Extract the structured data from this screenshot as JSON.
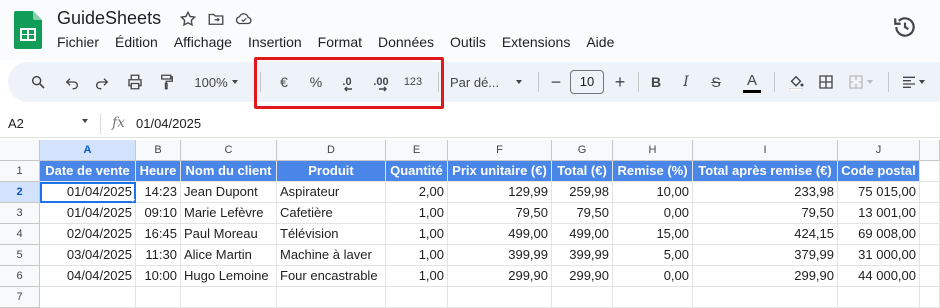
{
  "app": {
    "title": "GuideSheets"
  },
  "menu": [
    "Fichier",
    "Édition",
    "Affichage",
    "Insertion",
    "Format",
    "Données",
    "Outils",
    "Extensions",
    "Aide"
  ],
  "toolbar": {
    "zoom": "100%",
    "currency": "€",
    "percent": "%",
    "dec_decrease": ".0",
    "dec_increase": ".00",
    "number_format": "123",
    "font": "Par dé...",
    "font_size": "10",
    "minus": "−",
    "plus": "+",
    "bold": "B",
    "italic": "I",
    "strike": "S",
    "text_color": "A"
  },
  "formula_bar": {
    "cell_ref": "A2",
    "fx": "fx",
    "value": "01/04/2025"
  },
  "columns": [
    "A",
    "B",
    "C",
    "D",
    "E",
    "F",
    "G",
    "H",
    "I",
    "J"
  ],
  "rows": [
    "1",
    "2",
    "3",
    "4",
    "5",
    "6",
    "7"
  ],
  "headers": [
    "Date de vente",
    "Heure",
    "Nom du client",
    "Produit",
    "Quantité",
    "Prix unitaire (€)",
    "Total (€)",
    "Remise (%)",
    "Total après remise (€)",
    "Code postal"
  ],
  "data": [
    [
      "01/04/2025",
      "14:23",
      "Jean Dupont",
      "Aspirateur",
      "2,00",
      "129,99",
      "259,98",
      "10,00",
      "233,98",
      "75 015,00"
    ],
    [
      "01/04/2025",
      "09:10",
      "Marie Lefèvre",
      "Cafetière",
      "1,00",
      "79,50",
      "79,50",
      "0,00",
      "79,50",
      "13 001,00"
    ],
    [
      "02/04/2025",
      "16:45",
      "Paul Moreau",
      "Télévision",
      "1,00",
      "499,00",
      "499,00",
      "15,00",
      "424,15",
      "69 008,00"
    ],
    [
      "03/04/2025",
      "11:30",
      "Alice Martin",
      "Machine à laver",
      "1,00",
      "399,99",
      "399,99",
      "5,00",
      "379,99",
      "31 000,00"
    ],
    [
      "04/04/2025",
      "10:00",
      "Hugo Lemoine",
      "Four encastrable",
      "1,00",
      "299,90",
      "299,90",
      "0,00",
      "299,90",
      "44 000,00"
    ]
  ],
  "colors": {
    "header_fill": "#4a86e8",
    "highlight": "#e0181e",
    "selection": "#1a73e8"
  }
}
